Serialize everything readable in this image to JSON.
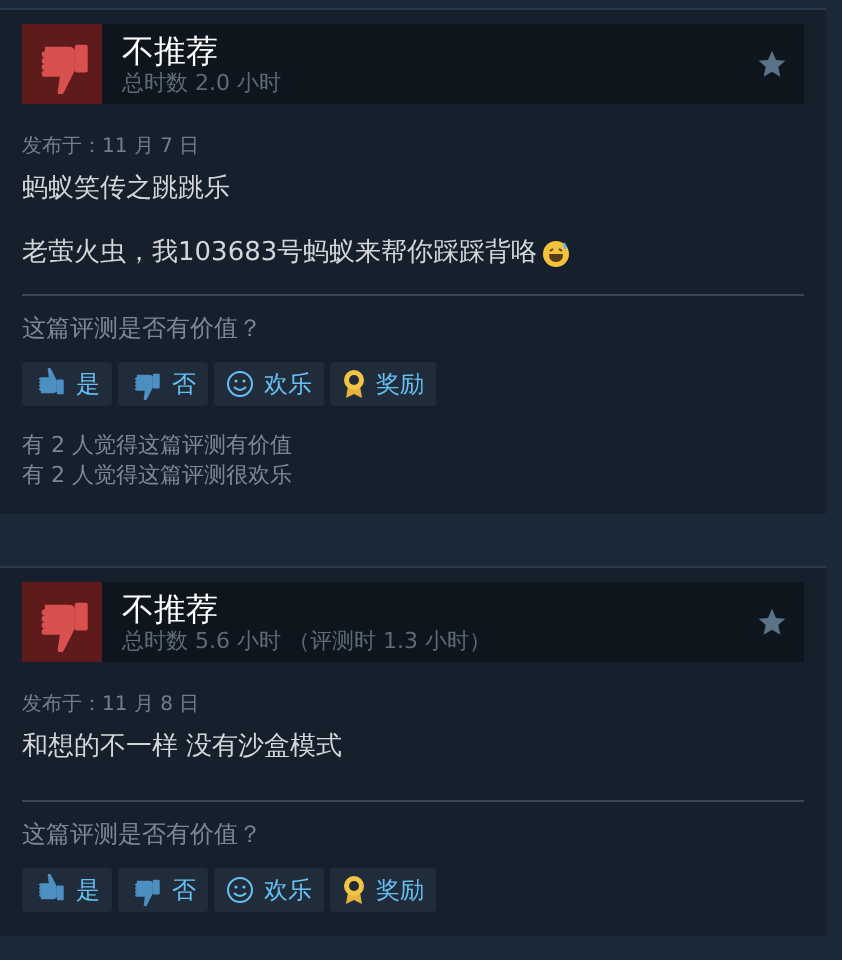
{
  "reviews": [
    {
      "verdict": "不推荐",
      "recommended": false,
      "hours": "总时数 2.0 小时",
      "posted": "发布于：11 月 7 日",
      "paragraphs": [
        [
          {
            "kind": "text",
            "text": "蚂蚁笑传之跳跳乐"
          }
        ],
        [
          {
            "kind": "text",
            "text": "老萤火虫，我103683号蚂蚁来帮你踩踩背咯"
          },
          {
            "kind": "emoji"
          }
        ]
      ],
      "prompt": "这篇评测是否有价值？",
      "buttons": [
        {
          "kind": "yes",
          "label": "是"
        },
        {
          "kind": "no",
          "label": "否"
        },
        {
          "kind": "funny",
          "label": "欢乐"
        },
        {
          "kind": "award",
          "label": "奖励"
        }
      ],
      "summary": [
        "有 2 人觉得这篇评测有价值",
        "有 2 人觉得这篇评测很欢乐"
      ]
    },
    {
      "verdict": "不推荐",
      "recommended": false,
      "hours": "总时数 5.6 小时",
      "hours_at_review": "（评测时 1.3 小时）",
      "posted": "发布于：11 月 8 日",
      "paragraphs": [
        [
          {
            "kind": "text",
            "text": "和想的不一样 没有沙盒模式"
          }
        ]
      ],
      "prompt": "这篇评测是否有价值？",
      "buttons": [
        {
          "kind": "yes",
          "label": "是"
        },
        {
          "kind": "no",
          "label": "否"
        },
        {
          "kind": "funny",
          "label": "欢乐"
        },
        {
          "kind": "award",
          "label": "奖励"
        }
      ]
    }
  ]
}
